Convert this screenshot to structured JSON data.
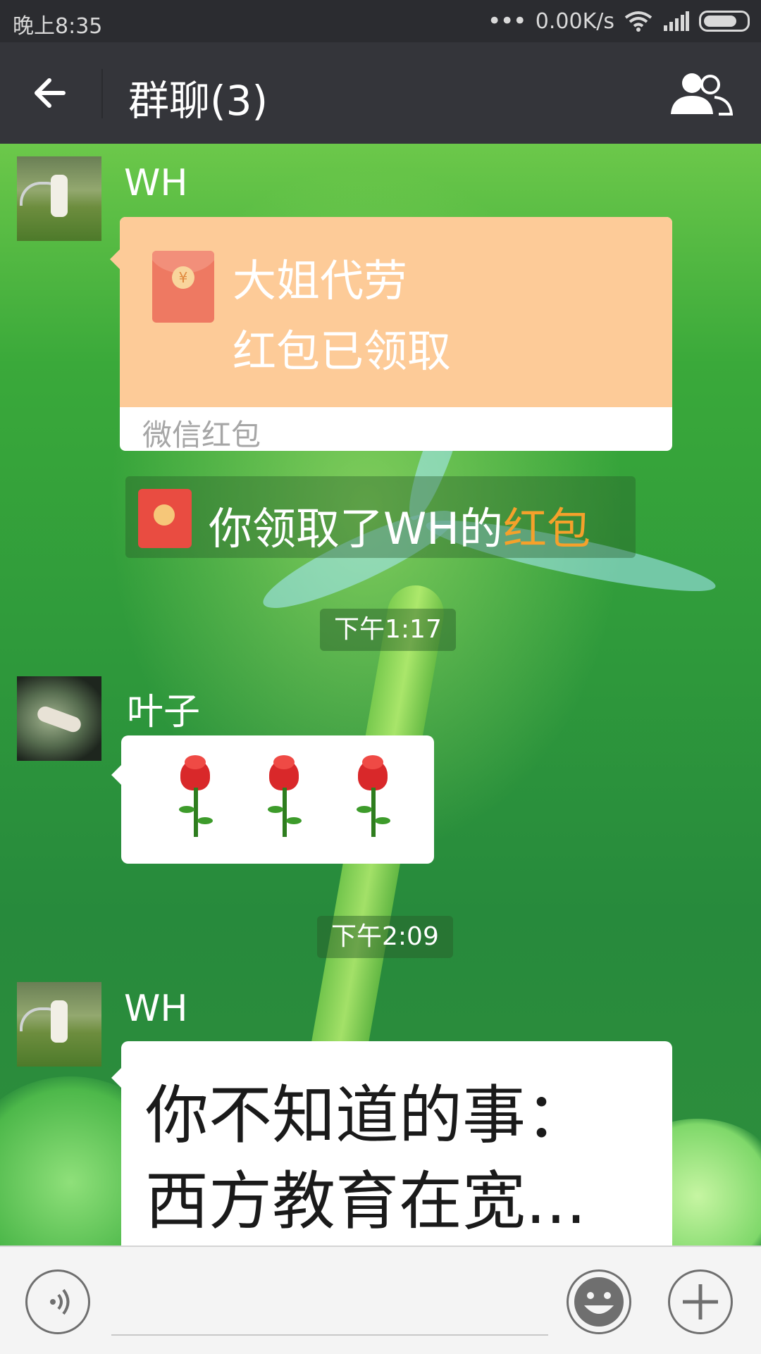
{
  "status_bar": {
    "time": "晚上8:35",
    "network_speed": "0.00K/s"
  },
  "header": {
    "title": "群聊(3)"
  },
  "messages": {
    "m1": {
      "sender": "WH",
      "packet_line1": "大姐代劳",
      "packet_line2": "红包已领取",
      "packet_footer": "微信红包",
      "packet_coin": "¥"
    },
    "notice": {
      "text": "你领取了WH的",
      "highlight": "红包"
    },
    "ts1": "下午1:17",
    "m2": {
      "sender": "叶子",
      "content": "🌹🌹🌹"
    },
    "ts2": "下午2:09",
    "m3": {
      "sender": "WH",
      "line1": "你不知道的事：",
      "line2": "西方教育在宽..."
    }
  },
  "colors": {
    "header_bg": "#34353a",
    "packet_bg": "#fdcb98",
    "packet_highlight": "#f5a12b",
    "chat_bg": "#2e8f3a"
  },
  "icons": [
    "back-arrow-icon",
    "group-members-icon",
    "voice-icon",
    "emoji-icon",
    "plus-icon",
    "wifi-icon",
    "signal-icon",
    "battery-icon",
    "red-packet-icon"
  ]
}
